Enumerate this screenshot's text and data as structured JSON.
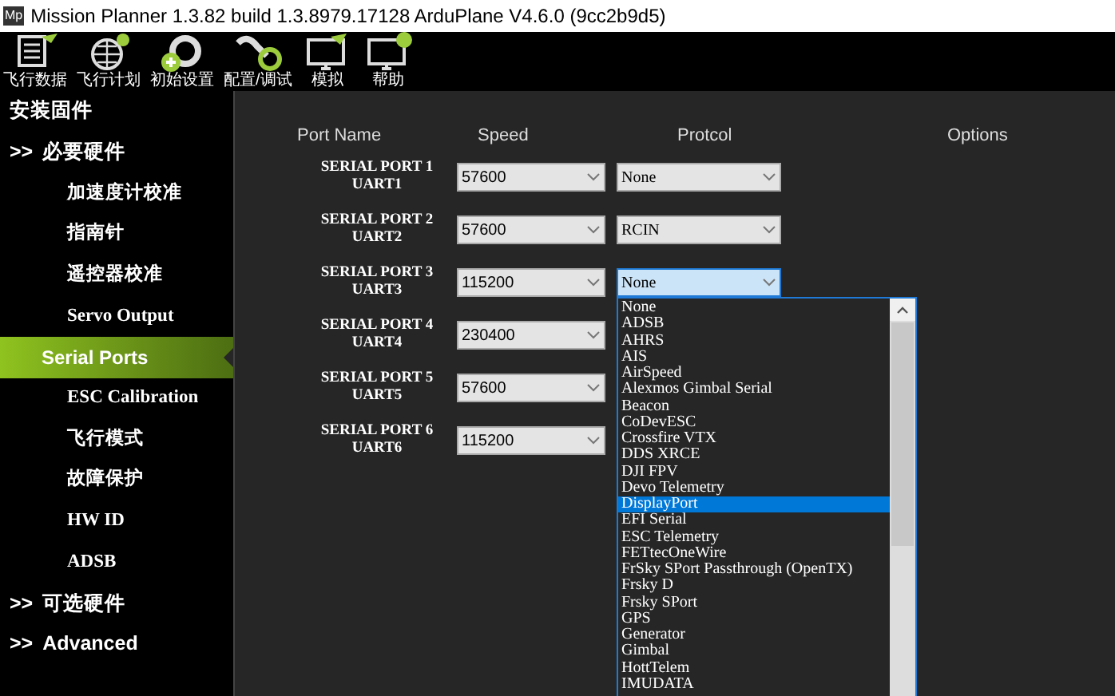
{
  "window": {
    "title": "Mission Planner 1.3.82 build 1.3.8979.17128 ArduPlane V4.6.0 (9cc2b9d5)",
    "logo": "Mp"
  },
  "toolbar": [
    {
      "label": "飞行数据",
      "kind": "data"
    },
    {
      "label": "飞行计划",
      "kind": "plan"
    },
    {
      "label": "初始设置",
      "kind": "setup"
    },
    {
      "label": "配置/调试",
      "kind": "config"
    },
    {
      "label": "模拟",
      "kind": "sim"
    },
    {
      "label": "帮助",
      "kind": "help"
    }
  ],
  "sidebar": {
    "items": [
      {
        "label": "安装固件",
        "kind": "top",
        "selected": false
      },
      {
        "label": "必要硬件",
        "kind": "group",
        "expanded": true,
        "selected": false,
        "children": [
          {
            "label": "加速度计校准",
            "selected": false
          },
          {
            "label": "指南针",
            "selected": false
          },
          {
            "label": "遥控器校准",
            "selected": false
          },
          {
            "label": "Servo Output",
            "selected": false
          },
          {
            "label": "Serial Ports",
            "selected": true
          },
          {
            "label": "ESC Calibration",
            "selected": false
          },
          {
            "label": "飞行模式",
            "selected": false
          },
          {
            "label": "故障保护",
            "selected": false
          },
          {
            "label": "HW ID",
            "selected": false
          },
          {
            "label": "ADSB",
            "selected": false
          }
        ]
      },
      {
        "label": "可选硬件",
        "kind": "group",
        "selected": false
      },
      {
        "label": "Advanced",
        "kind": "group",
        "selected": false
      }
    ],
    "group_marker": ">>"
  },
  "table": {
    "columns": [
      "Port Name",
      "Speed",
      "Protcol",
      "Options"
    ],
    "rows": [
      {
        "port": "SERIAL PORT 1",
        "uart": "UART1",
        "speed": "57600",
        "protocol": "None",
        "open": false
      },
      {
        "port": "SERIAL PORT 2",
        "uart": "UART2",
        "speed": "57600",
        "protocol": "RCIN",
        "open": false
      },
      {
        "port": "SERIAL PORT 3",
        "uart": "UART3",
        "speed": "115200",
        "protocol": "None",
        "open": true
      },
      {
        "port": "SERIAL PORT 4",
        "uart": "UART4",
        "speed": "230400"
      },
      {
        "port": "SERIAL PORT 5",
        "uart": "UART5",
        "speed": "57600"
      },
      {
        "port": "SERIAL PORT 6",
        "uart": "UART6",
        "speed": "115200"
      }
    ]
  },
  "dropdown": {
    "items": [
      {
        "label": "None",
        "selected": false
      },
      {
        "label": "ADSB",
        "selected": false
      },
      {
        "label": "AHRS",
        "selected": false
      },
      {
        "label": "AIS",
        "selected": false
      },
      {
        "label": "AirSpeed",
        "selected": false
      },
      {
        "label": "Alexmos Gimbal Serial",
        "selected": false
      },
      {
        "label": "Beacon",
        "selected": false
      },
      {
        "label": "CoDevESC",
        "selected": false
      },
      {
        "label": "Crossfire VTX",
        "selected": false
      },
      {
        "label": "DDS XRCE",
        "selected": false
      },
      {
        "label": "DJI FPV",
        "selected": false
      },
      {
        "label": "Devo Telemetry",
        "selected": false
      },
      {
        "label": "DisplayPort",
        "selected": true
      },
      {
        "label": "EFI Serial",
        "selected": false
      },
      {
        "label": "ESC Telemetry",
        "selected": false
      },
      {
        "label": "FETtecOneWire",
        "selected": false
      },
      {
        "label": "FrSky SPort Passthrough (OpenTX)",
        "selected": false
      },
      {
        "label": "Frsky D",
        "selected": false
      },
      {
        "label": "Frsky SPort",
        "selected": false
      },
      {
        "label": "GPS",
        "selected": false
      },
      {
        "label": "Generator",
        "selected": false
      },
      {
        "label": "Gimbal",
        "selected": false
      },
      {
        "label": "HottTelem",
        "selected": false
      },
      {
        "label": "IMUDATA",
        "selected": false
      }
    ]
  }
}
